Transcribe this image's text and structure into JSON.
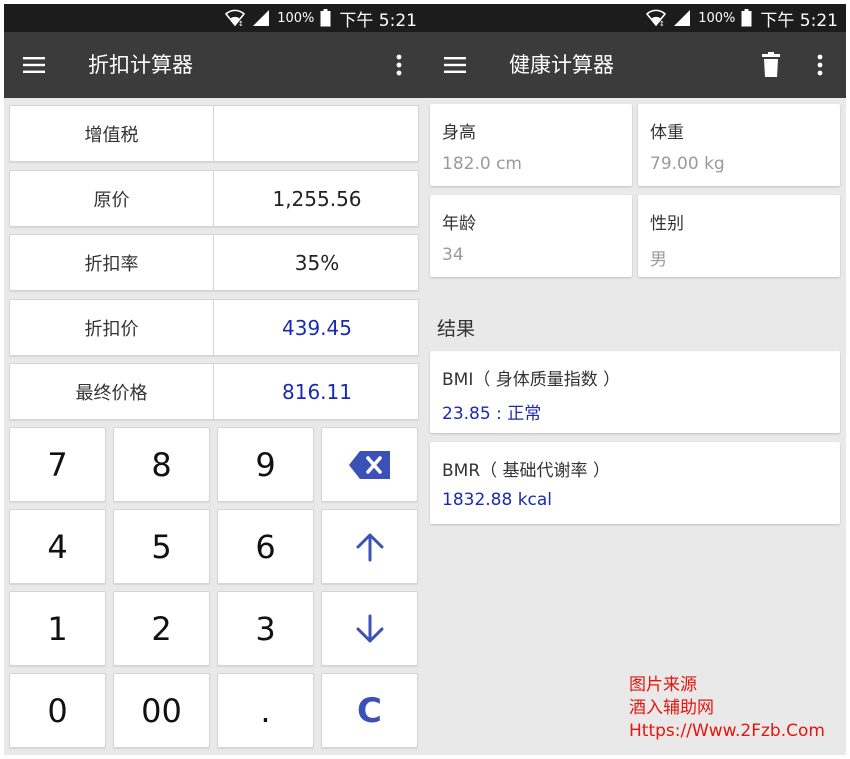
{
  "status_bar": {
    "battery_percent": "100%",
    "time": "下午 5:21",
    "wifi_icon": "wifi-icon",
    "signal_icon": "signal-icon",
    "battery_icon": "battery-icon"
  },
  "discount_app": {
    "title": "折扣计算器",
    "menu_icon": "hamburger-menu-icon",
    "more_icon": "more-vert-icon",
    "fields": [
      {
        "label": "增值税",
        "value": ""
      },
      {
        "label": "原价",
        "value": "1,255.56"
      },
      {
        "label": "折扣率",
        "value": "35%"
      },
      {
        "label": "折扣价",
        "value": "439.45"
      },
      {
        "label": "最终价格",
        "value": "816.11"
      }
    ],
    "keypad": [
      [
        "7",
        "8",
        "9",
        "backspace"
      ],
      [
        "4",
        "5",
        "6",
        "up"
      ],
      [
        "1",
        "2",
        "3",
        "down"
      ],
      [
        "0",
        "00",
        ".",
        "C"
      ]
    ]
  },
  "health_app": {
    "title": "健康计算器",
    "menu_icon": "hamburger-menu-icon",
    "delete_icon": "trash-icon",
    "more_icon": "more-vert-icon",
    "inputs": [
      {
        "label": "身高",
        "value": "182.0 cm"
      },
      {
        "label": "体重",
        "value": "79.00 kg"
      },
      {
        "label": "年龄",
        "value": "34"
      },
      {
        "label": "性别",
        "value": "男"
      }
    ],
    "results_title": "结果",
    "results": [
      {
        "label": "BMI（ 身体质量指数 ）",
        "value": "23.85 : 正常"
      },
      {
        "label": "BMR（ 基础代谢率 ）",
        "value": "1832.88 kcal"
      }
    ]
  },
  "watermark": {
    "line1": "图片来源",
    "line2": "酒入辅助网",
    "line3": "Https://Www.2Fzb.Com"
  },
  "colors": {
    "app_bar": "#3b3b3b",
    "status_bar": "#1c1c1c",
    "background": "#e9e9e9",
    "accent_blue": "#1a2bb0",
    "key_accent": "#3c51b8",
    "watermark_red": "#e8150c"
  }
}
